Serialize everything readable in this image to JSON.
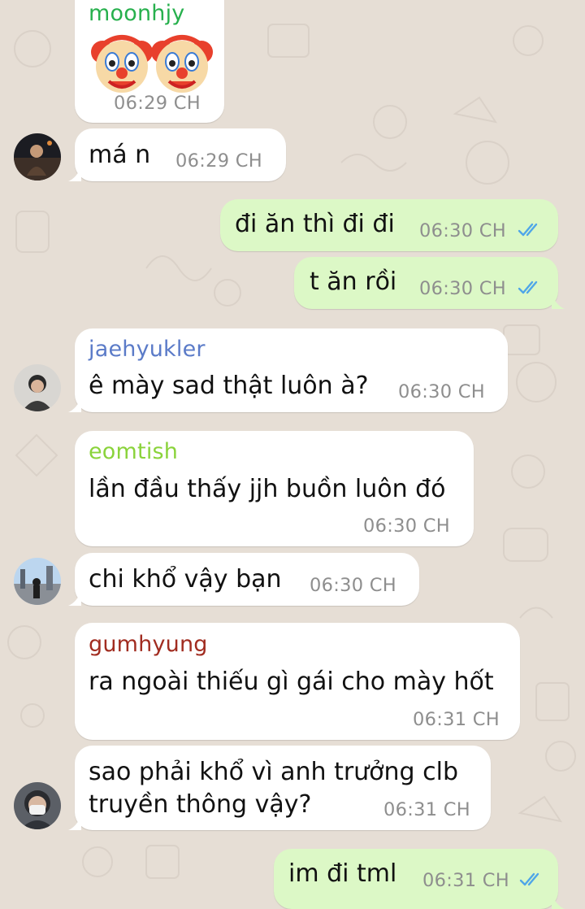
{
  "colors": {
    "incoming_bubble": "#ffffff",
    "outgoing_bubble": "#dcf8c6",
    "chat_background": "#e6ded5",
    "timestamp": "#8e8e8e",
    "read_ticks": "#4fa6e8"
  },
  "messages": [
    {
      "sender": "moonhjy",
      "sender_color": "#27b04d",
      "content": "clown-face-emoji x2",
      "time": "06:29 CH"
    },
    {
      "text": "má n",
      "time": "06:29 CH"
    },
    {
      "direction": "outgoing",
      "text": "đi ăn thì đi đi",
      "time": "06:30 CH",
      "status": "read-ticks-icon"
    },
    {
      "direction": "outgoing",
      "text": "t ăn rồi",
      "time": "06:30 CH",
      "status": "read-ticks-icon"
    },
    {
      "sender": "jaehyukler",
      "sender_color": "#5b7bc8",
      "text": "ê mày sad thật luôn à?",
      "time": "06:30 CH"
    },
    {
      "sender": "eomtish",
      "sender_color": "#8ad33b",
      "text": "lần đầu thấy jjh buồn luôn đó",
      "time": "06:30 CH"
    },
    {
      "text": "chi khổ vậy bạn",
      "time": "06:30 CH"
    },
    {
      "sender": "gumhyung",
      "sender_color": "#a12c20",
      "text": "ra ngoài thiếu gì gái cho mày hốt",
      "time": "06:31 CH"
    },
    {
      "text_line1": "sao phải khổ vì anh trưởng clb",
      "text_line2": "truyền thông vậy?",
      "time": "06:31 CH"
    },
    {
      "direction": "outgoing",
      "text": "im đi tml",
      "time": "06:31 CH",
      "status": "read-ticks-icon"
    }
  ]
}
